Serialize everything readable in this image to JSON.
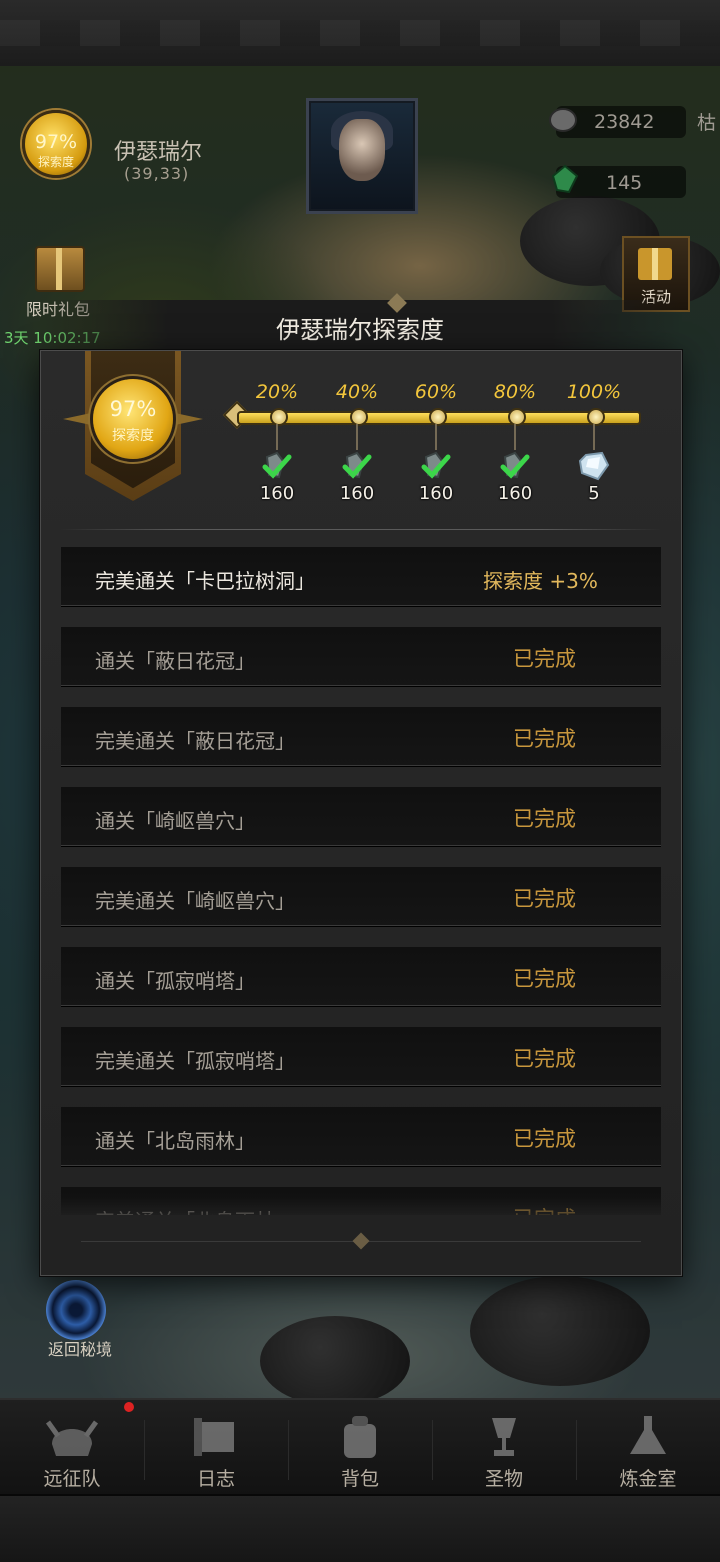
{
  "hud": {
    "exploration_percent": "97%",
    "exploration_label": "探索度",
    "region_name": "伊瑟瑞尔",
    "region_coords": "(39,33)",
    "resource_1": "23842",
    "resource_1_suffix": "枯",
    "resource_2": "145",
    "limited_gift_label": "限时礼包",
    "limited_gift_timer": "3天 10:02:17",
    "activity_label": "活动",
    "return_label": "返回秘境"
  },
  "modal": {
    "title": "伊瑟瑞尔探索度",
    "progress_percent": "97%",
    "progress_label": "探索度",
    "progress_value": 0.97,
    "milestones": [
      {
        "percent": "20%",
        "count": "160",
        "icon": "crystal-shard-icon",
        "claimed": true
      },
      {
        "percent": "40%",
        "count": "160",
        "icon": "crystal-shard-icon",
        "claimed": true
      },
      {
        "percent": "60%",
        "count": "160",
        "icon": "crystal-shard-icon",
        "claimed": true
      },
      {
        "percent": "80%",
        "count": "160",
        "icon": "crystal-shard-icon",
        "claimed": true
      },
      {
        "percent": "100%",
        "count": "5",
        "icon": "diamond-crystal-icon",
        "claimed": false
      }
    ],
    "tasks": [
      {
        "task": "完美通关「卡巴拉树洞」",
        "reward": "探索度 +3%",
        "status": ""
      },
      {
        "task": "通关「蔽日花冠」",
        "reward": "",
        "status": "已完成"
      },
      {
        "task": "完美通关「蔽日花冠」",
        "reward": "",
        "status": "已完成"
      },
      {
        "task": "通关「崎岖兽穴」",
        "reward": "",
        "status": "已完成"
      },
      {
        "task": "完美通关「崎岖兽穴」",
        "reward": "",
        "status": "已完成"
      },
      {
        "task": "通关「孤寂哨塔」",
        "reward": "",
        "status": "已完成"
      },
      {
        "task": "完美通关「孤寂哨塔」",
        "reward": "",
        "status": "已完成"
      },
      {
        "task": "通关「北岛雨林」",
        "reward": "",
        "status": "已完成"
      },
      {
        "task": "完美通关「北岛雨林」",
        "reward": "",
        "status": "已完成"
      }
    ]
  },
  "nav": {
    "items": [
      {
        "label": "远征队",
        "icon": "helmet-icon",
        "badge": true
      },
      {
        "label": "日志",
        "icon": "scroll-icon",
        "badge": false
      },
      {
        "label": "背包",
        "icon": "backpack-icon",
        "badge": false
      },
      {
        "label": "圣物",
        "icon": "chalice-icon",
        "badge": false
      },
      {
        "label": "炼金室",
        "icon": "alchemy-icon",
        "badge": false
      }
    ]
  },
  "colors": {
    "gold": "#f3c63c",
    "status_gold": "#c8973d",
    "timer_green": "#6fd36f"
  }
}
